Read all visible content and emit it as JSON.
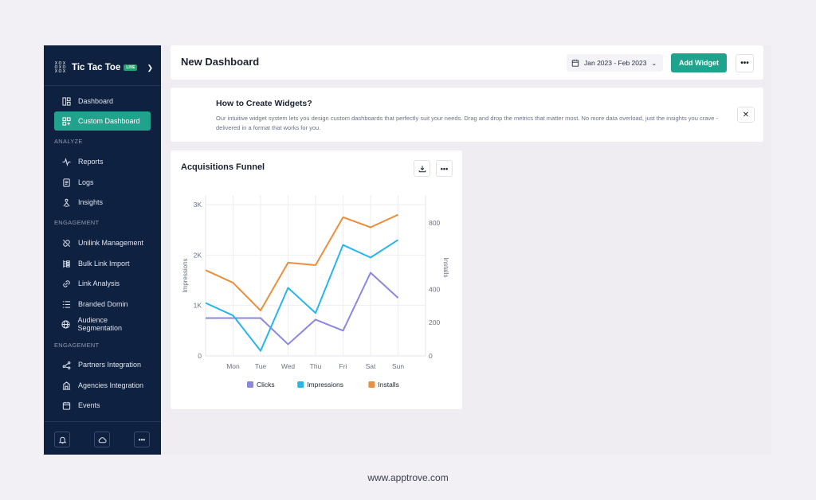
{
  "sidebar": {
    "brand": {
      "name": "Tic Tac Toe",
      "badge": "LIVE",
      "logo_glyphs": [
        "X",
        "O",
        "X",
        "O",
        "X",
        "O",
        "X",
        "O",
        "X"
      ]
    },
    "items_main": [
      {
        "label": "Dashboard",
        "icon": "dashboard-icon"
      },
      {
        "label": "Custom Dashboard",
        "icon": "custom-dashboard-icon",
        "active": true
      }
    ],
    "section_analyze": "ANALYZE",
    "items_analyze": [
      {
        "label": "Reports",
        "icon": "pulse-icon"
      },
      {
        "label": "Logs",
        "icon": "document-icon"
      },
      {
        "label": "Insights",
        "icon": "insights-icon"
      }
    ],
    "section_engagement": "ENGAGEMENT",
    "items_engagement": [
      {
        "label": "Unilink Management",
        "icon": "link-off-icon"
      },
      {
        "label": "Bulk Link Import",
        "icon": "bulk-icon"
      },
      {
        "label": "Link Analysis",
        "icon": "link-icon"
      },
      {
        "label": "Branded Domin",
        "icon": "list-icon"
      },
      {
        "label": "Audience Segmentation",
        "icon": "globe-icon"
      }
    ],
    "section_engagement_2": "ENGAGEMENT",
    "items_engagement_2": [
      {
        "label": "Partners Integration",
        "icon": "share-icon"
      },
      {
        "label": "Agencies Integration",
        "icon": "building-icon"
      },
      {
        "label": "Events",
        "icon": "calendar-icon"
      }
    ],
    "bottom_more": "•••"
  },
  "header": {
    "title": "New Dashboard",
    "date_range": "Jan 2023 - Feb 2023",
    "add_widget": "Add Widget",
    "more": "•••"
  },
  "info": {
    "title": "How to Create Widgets?",
    "text": "Our intuitive widget system lets you design custom dashboards that perfectly suit your needs.  Drag and drop the metrics that matter most.  No more data overload, just the insights you crave - delivered in a format that works for you.",
    "close": "✕"
  },
  "widget": {
    "title": "Acquisitions Funnel",
    "more": "•••"
  },
  "chart_data": {
    "type": "line",
    "title": "Acquisitions Funnel",
    "categories": [
      "",
      "Mon",
      "Tue",
      "Wed",
      "Thu",
      "Fri",
      "Sat",
      "Sun",
      ""
    ],
    "y_left": {
      "label": "Impressions",
      "ticks": [
        "0",
        "1K",
        "2K",
        "3K"
      ],
      "lim": [
        0,
        3000
      ]
    },
    "y_right": {
      "label": "Installs",
      "ticks": [
        "0",
        "200",
        "400",
        "800"
      ],
      "tick_values": [
        0,
        200,
        400,
        800
      ]
    },
    "series": [
      {
        "name": "Clicks",
        "color": "#8b87e0",
        "values": [
          750,
          750,
          750,
          230,
          720,
          500,
          1650,
          1150
        ]
      },
      {
        "name": "Impressions",
        "color": "#27b5ea",
        "values": [
          1050,
          800,
          100,
          1350,
          850,
          2200,
          1950,
          2300
        ]
      },
      {
        "name": "Installs",
        "color": "#e98f3d",
        "values": [
          1700,
          1450,
          900,
          1850,
          1800,
          2750,
          2550,
          2800
        ]
      }
    ],
    "legend_position": "bottom",
    "grid": true
  },
  "footer": {
    "url": "www.apptrove.com"
  }
}
